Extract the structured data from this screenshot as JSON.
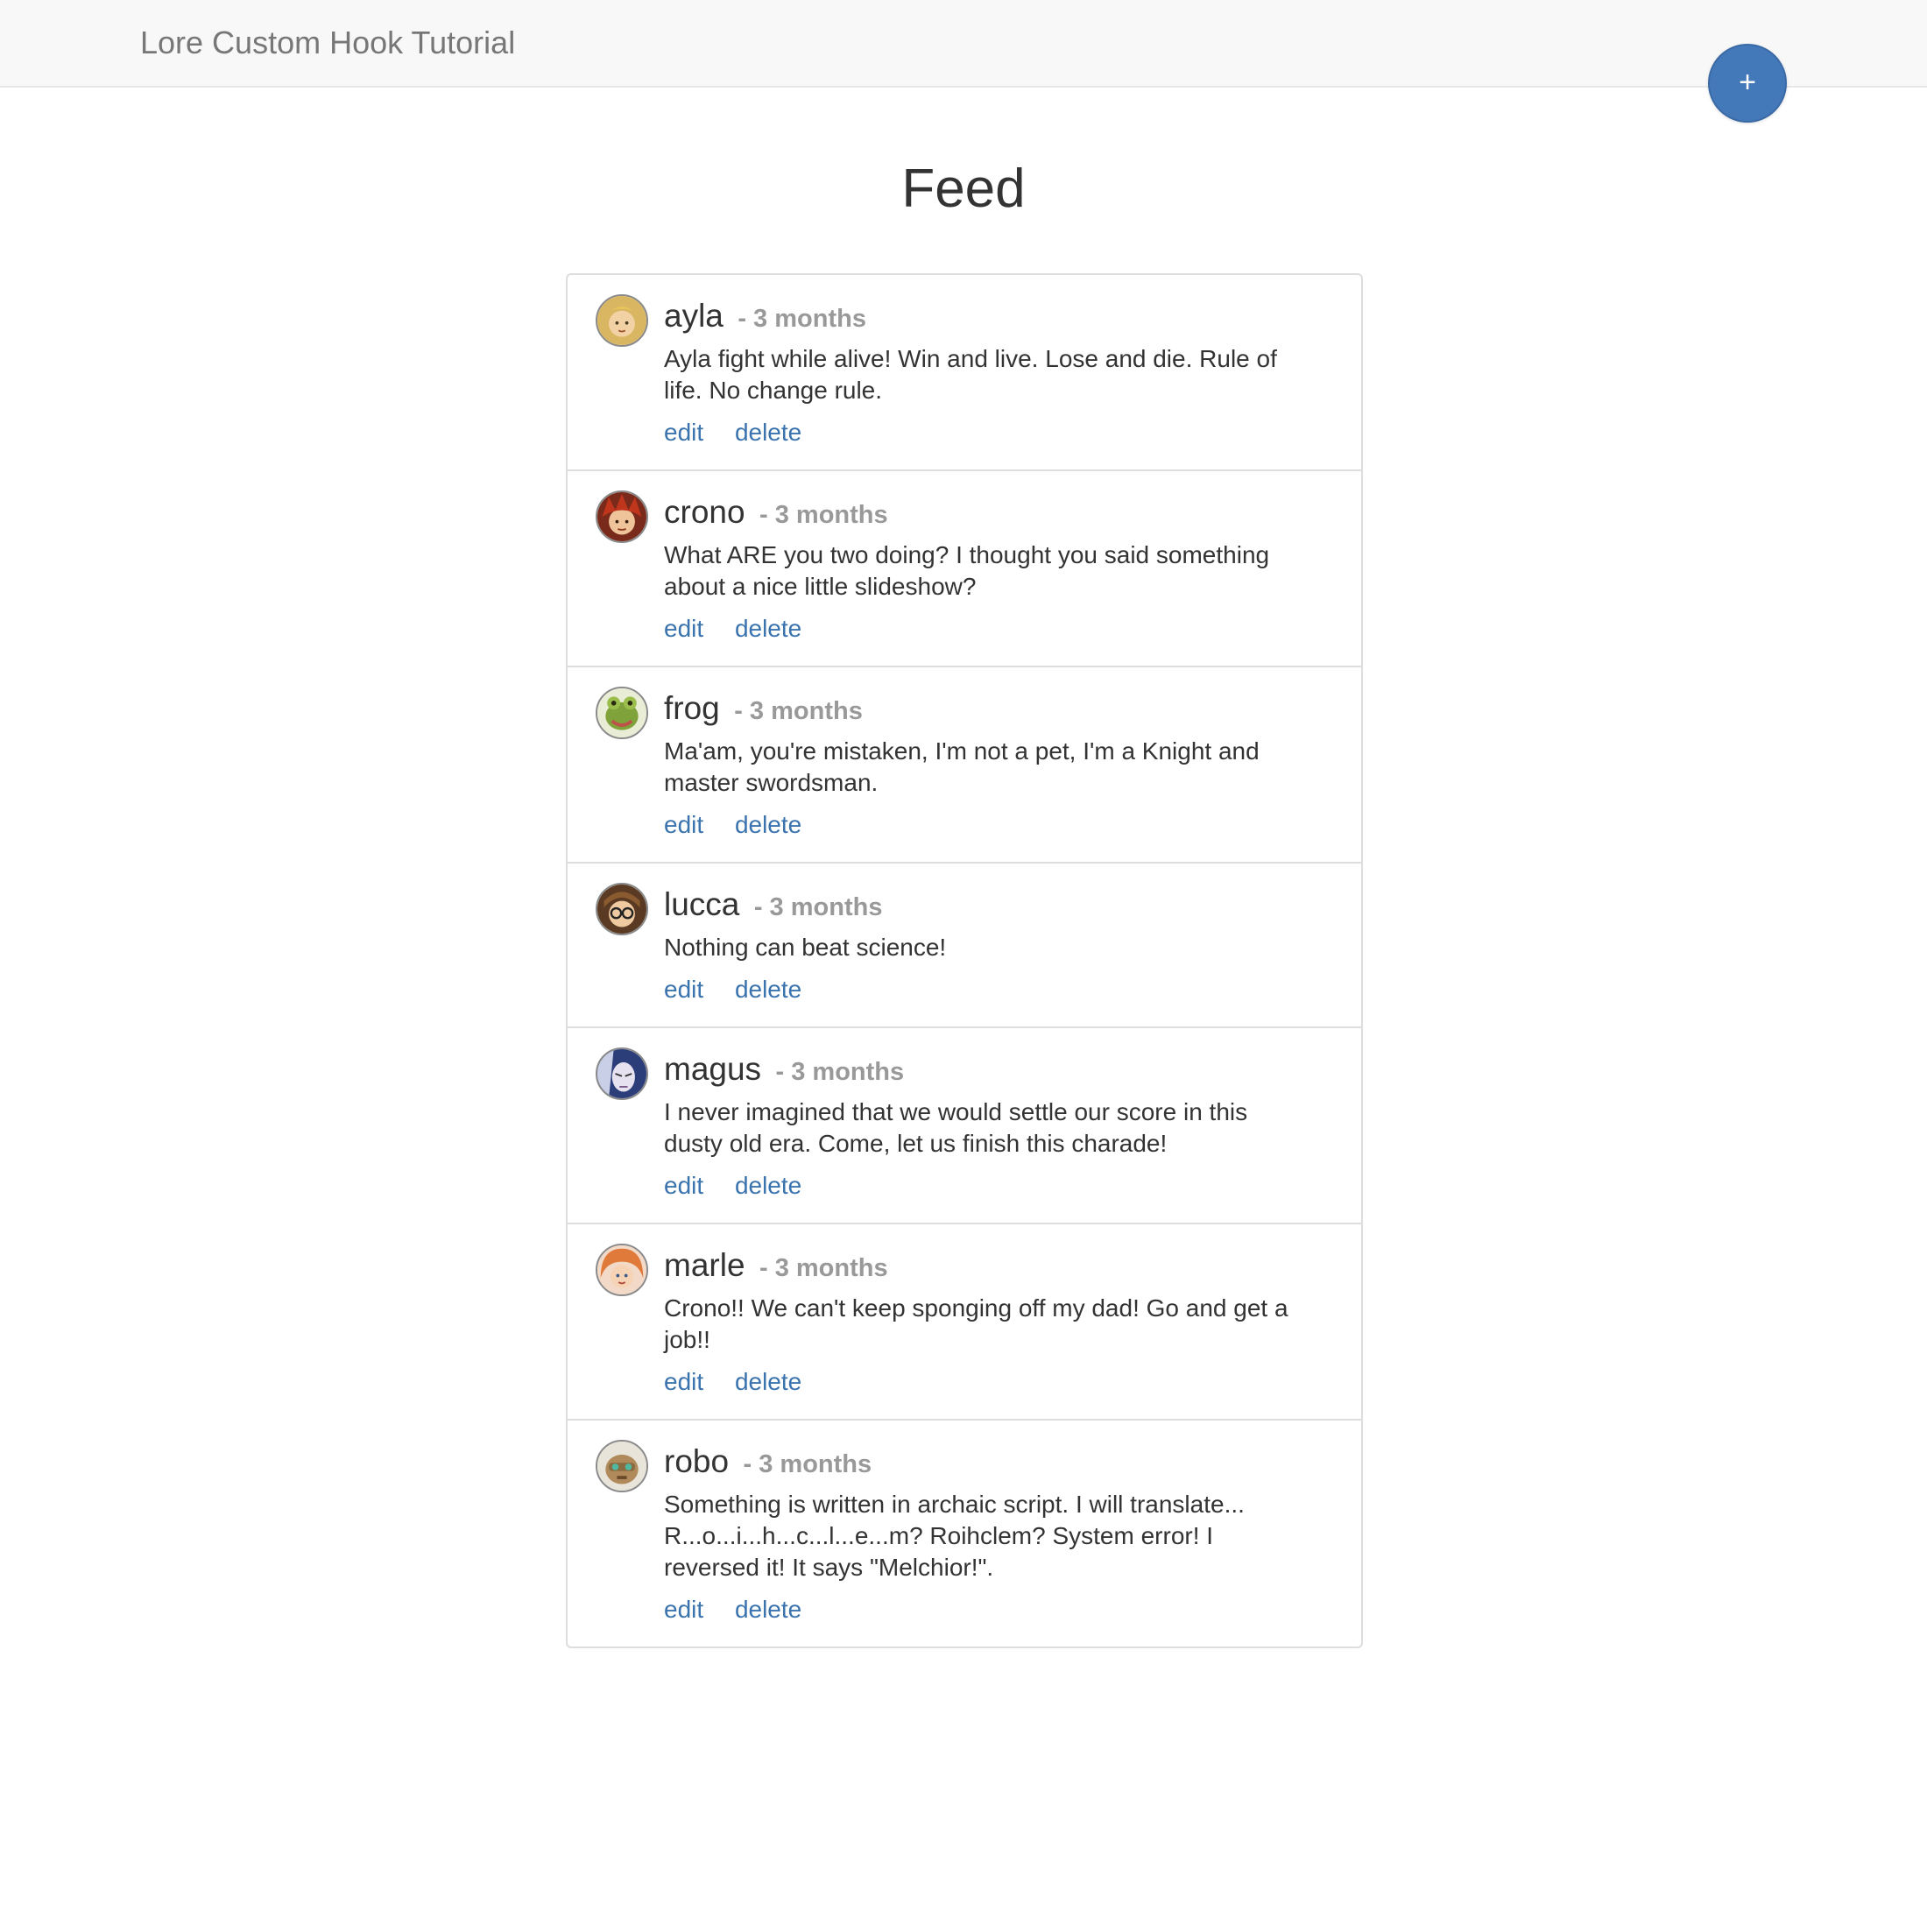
{
  "navbar": {
    "brand": "Lore Custom Hook Tutorial",
    "add_button_label": "+"
  },
  "page": {
    "title": "Feed"
  },
  "colors": {
    "accent": "#4479b9",
    "link": "#3a73ad",
    "muted": "#999999"
  },
  "posts": [
    {
      "author": "ayla",
      "time": "- 3 months",
      "text": "Ayla fight while alive! Win and live. Lose and die. Rule of life. No change rule.",
      "edit_label": "edit",
      "delete_label": "delete",
      "avatar_icon": "avatar-ayla-icon"
    },
    {
      "author": "crono",
      "time": "- 3 months",
      "text": "What ARE you two doing? I thought you said something about a nice little slideshow?",
      "edit_label": "edit",
      "delete_label": "delete",
      "avatar_icon": "avatar-crono-icon"
    },
    {
      "author": "frog",
      "time": "- 3 months",
      "text": "Ma'am, you're mistaken, I'm not a pet, I'm a Knight and master swordsman.",
      "edit_label": "edit",
      "delete_label": "delete",
      "avatar_icon": "avatar-frog-icon"
    },
    {
      "author": "lucca",
      "time": "- 3 months",
      "text": "Nothing can beat science!",
      "edit_label": "edit",
      "delete_label": "delete",
      "avatar_icon": "avatar-lucca-icon"
    },
    {
      "author": "magus",
      "time": "- 3 months",
      "text": "I never imagined that we would settle our score in this dusty old era. Come, let us finish this charade!",
      "edit_label": "edit",
      "delete_label": "delete",
      "avatar_icon": "avatar-magus-icon"
    },
    {
      "author": "marle",
      "time": "- 3 months",
      "text": "Crono!! We can't keep sponging off my dad! Go and get a job!!",
      "edit_label": "edit",
      "delete_label": "delete",
      "avatar_icon": "avatar-marle-icon"
    },
    {
      "author": "robo",
      "time": "- 3 months",
      "text": "Something is written in archaic script. I will translate... R...o...i...h...c...l...e...m? Roihclem? System error! I reversed it! It says \"Melchior!\".",
      "edit_label": "edit",
      "delete_label": "delete",
      "avatar_icon": "avatar-robo-icon"
    }
  ]
}
